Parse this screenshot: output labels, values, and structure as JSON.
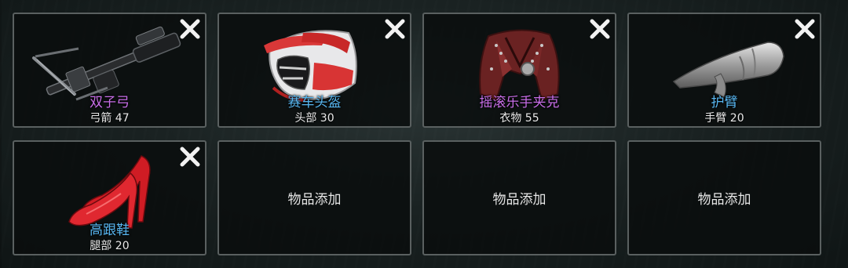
{
  "colors": {
    "rarity_purple": "#c86ee8",
    "rarity_blue": "#58b6f0",
    "border": "#5a6060",
    "slot_bg": "#0a0e0e"
  },
  "slots": [
    {
      "name": "双子弓",
      "stat": "弓箭 47",
      "name_color": "#c86ee8",
      "icon": "crossbow-icon"
    },
    {
      "name": "赛车头盔",
      "stat": "头部 30",
      "name_color": "#58b6f0",
      "icon": "racing-helmet-icon"
    },
    {
      "name": "摇滚乐手夹克",
      "stat": "衣物 55",
      "name_color": "#c86ee8",
      "icon": "rocker-jacket-icon"
    },
    {
      "name": "护臂",
      "stat": "手臂 20",
      "name_color": "#58b6f0",
      "icon": "arm-guard-icon"
    },
    {
      "name": "高跟鞋",
      "stat": "腿部 20",
      "name_color": "#58b6f0",
      "icon": "high-heels-icon"
    }
  ],
  "empty_slots": [
    {
      "label": "物品添加"
    },
    {
      "label": "物品添加"
    },
    {
      "label": "物品添加"
    }
  ],
  "close_icon": "close-icon"
}
